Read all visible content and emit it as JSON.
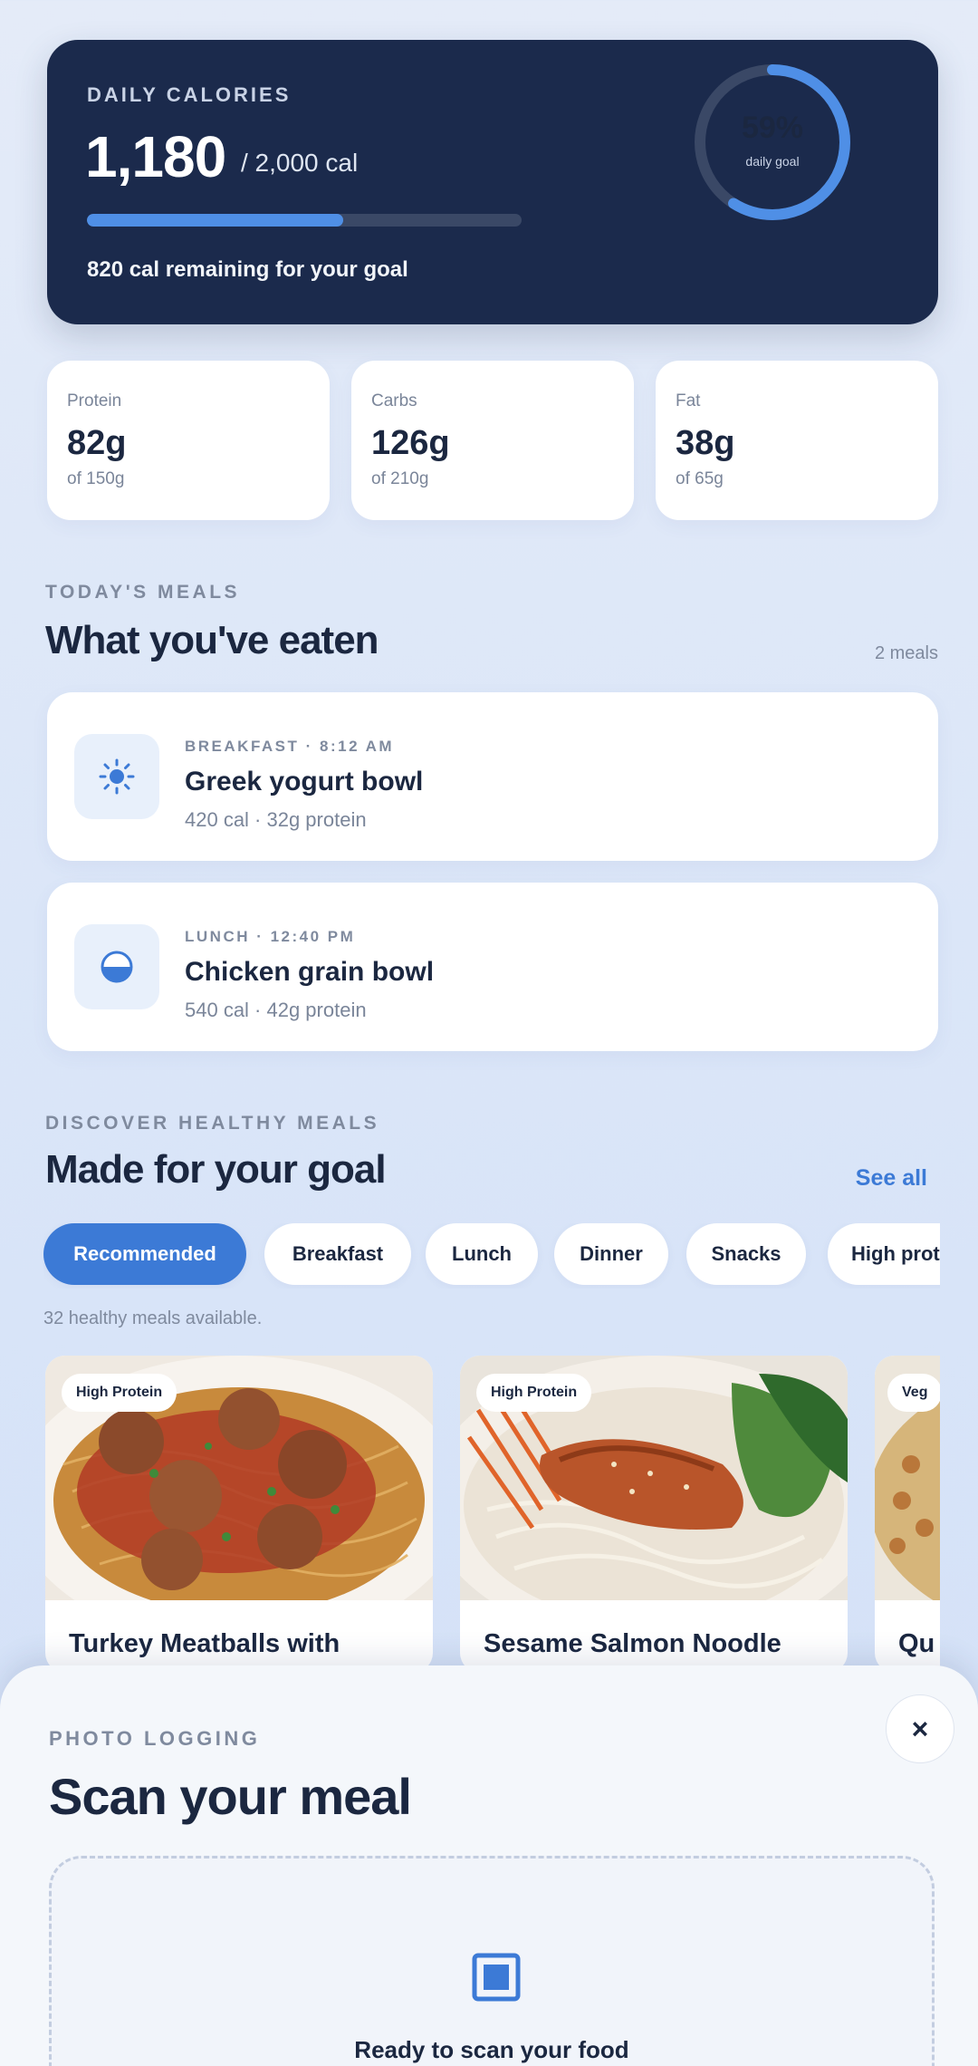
{
  "calories": {
    "label": "DAILY CALORIES",
    "value": "1,180",
    "goal": "/ 2,000 cal",
    "progress_fraction": 0.59,
    "remaining_text": "820 cal remaining for your goal",
    "ring_percent": "59%",
    "ring_caption": "daily goal"
  },
  "macros": [
    {
      "label": "Protein",
      "value": "82g",
      "of": "of 150g"
    },
    {
      "label": "Carbs",
      "value": "126g",
      "of": "of 210g"
    },
    {
      "label": "Fat",
      "value": "38g",
      "of": "of 65g"
    }
  ],
  "todays_meals": {
    "eyebrow": "TODAY'S MEALS",
    "title": "What you've eaten",
    "count": "2 meals",
    "items": [
      {
        "icon": "sun-icon",
        "tag": "BREAKFAST · 8:12 AM",
        "name": "Greek yogurt bowl",
        "meta": "420 cal · 32g protein"
      },
      {
        "icon": "half-circle-bowl-icon",
        "tag": "LUNCH · 12:40 PM",
        "name": "Chicken grain bowl",
        "meta": "540 cal · 42g protein"
      }
    ]
  },
  "discover": {
    "eyebrow": "DISCOVER HEALTHY MEALS",
    "title": "Made for your goal",
    "see_all": "See all",
    "filters": [
      "Recommended",
      "Breakfast",
      "Lunch",
      "Dinner",
      "Snacks",
      "High protein"
    ],
    "active_filter": "Recommended",
    "available_text": "32 healthy meals available.",
    "cards": [
      {
        "badge": "High Protein",
        "title": "Turkey Meatballs with"
      },
      {
        "badge": "High Protein",
        "title": "Sesame Salmon Noodle"
      },
      {
        "badge": "Veg",
        "title": "Qu"
      }
    ]
  },
  "scan_sheet": {
    "eyebrow": "PHOTO LOGGING",
    "title": "Scan your meal",
    "close_label": "×",
    "status_text": "Ready to scan your food"
  },
  "colors": {
    "card_navy": "#1b2a4c",
    "accent_blue": "#3c7ad6",
    "ring_blue": "#4f8fe6"
  }
}
